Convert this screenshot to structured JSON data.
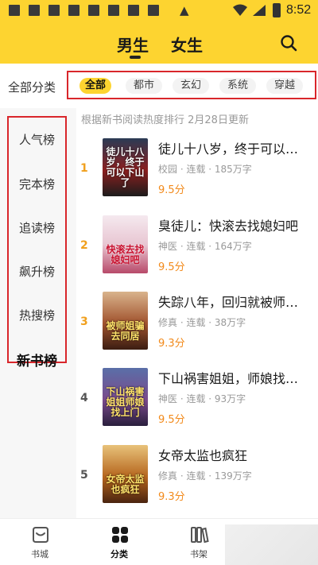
{
  "status_bar": {
    "time": "8:52",
    "warning_glyph": "▲"
  },
  "header": {
    "tabs": [
      "男生",
      "女生"
    ],
    "active_tab": "男生",
    "search_icon": "search-icon"
  },
  "category": {
    "label": "全部分类",
    "chips": [
      "全部",
      "都市",
      "玄幻",
      "系统",
      "穿越"
    ],
    "active": "全部"
  },
  "sidebar": {
    "items": [
      "人气榜",
      "完本榜",
      "追读榜",
      "飙升榜",
      "热搜榜",
      "新书榜"
    ],
    "active": "新书榜"
  },
  "list": {
    "note": "根据新书阅读热度排行 2月28日更新",
    "books": [
      {
        "rank": "1",
        "title": "徒儿十八岁，终于可以…",
        "meta": "校园 · 连载 · 185万字",
        "score": "9.5分",
        "cover_text": "徒儿十八岁，终于可以下山了"
      },
      {
        "rank": "2",
        "title": "臭徒儿：快滚去找媳妇吧",
        "meta": "神医 · 连载 · 164万字",
        "score": "9.5分",
        "cover_text": "快滚去找媳妇吧"
      },
      {
        "rank": "3",
        "title": "失踪八年，回归就被师…",
        "meta": "修真 · 连载 · 38万字",
        "score": "9.3分",
        "cover_text": "被师姐骗去同居"
      },
      {
        "rank": "4",
        "title": "下山祸害姐姐，师娘找…",
        "meta": "神医 · 连载 · 93万字",
        "score": "9.5分",
        "cover_text": "下山祸害姐姐师娘找上门"
      },
      {
        "rank": "5",
        "title": "女帝太监也疯狂",
        "meta": "修真 · 连载 · 139万字",
        "score": "9.3分",
        "cover_text": "女帝太监也疯狂"
      }
    ]
  },
  "bottom_nav": {
    "items": [
      {
        "label": "书城",
        "icon": "bookstore-icon"
      },
      {
        "label": "分类",
        "icon": "category-icon"
      },
      {
        "label": "书架",
        "icon": "bookshelf-icon"
      }
    ],
    "active": "分类"
  },
  "colors": {
    "accent": "#fdd430",
    "score": "#f28a1b",
    "highlight_box": "#d9262b",
    "rank_top": "#f0a01e",
    "rank_other": "#555555"
  }
}
